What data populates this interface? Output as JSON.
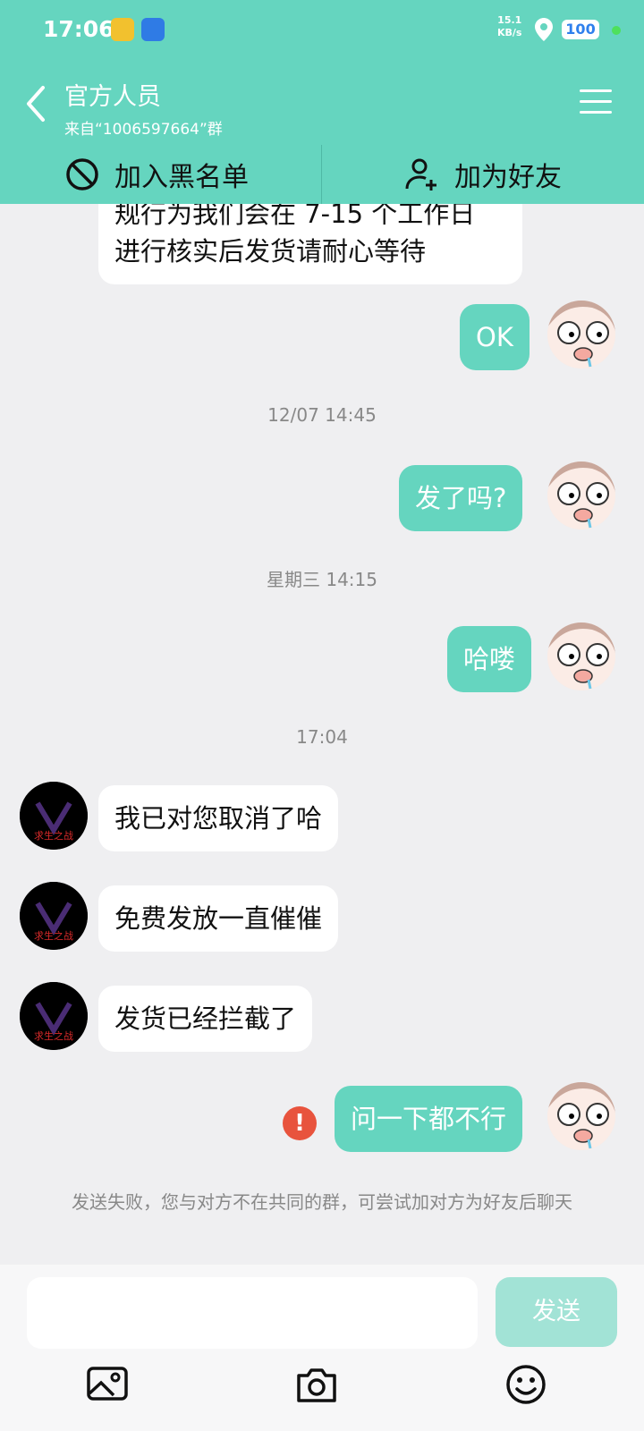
{
  "status_bar": {
    "time": "17:06",
    "net_speed_value": "15.1",
    "net_speed_unit": "KB/s",
    "battery": "100"
  },
  "header": {
    "title": "官方人员",
    "subtitle": "来自“1006597664”群",
    "blacklist_label": "加入黑名单",
    "add_friend_label": "加为好友"
  },
  "messages": [
    {
      "type": "in",
      "text_line1": "规行为我们会在 7-15 个工作日",
      "text_line2": "进行核实后发货请耐心等待"
    },
    {
      "type": "out",
      "text": "OK"
    },
    {
      "type": "time",
      "text": "12/07 14:45"
    },
    {
      "type": "out",
      "text": "发了吗?"
    },
    {
      "type": "time",
      "text": "星期三 14:15"
    },
    {
      "type": "out",
      "text": "哈喽"
    },
    {
      "type": "time",
      "text": "17:04"
    },
    {
      "type": "in",
      "text": "我已对您取消了哈"
    },
    {
      "type": "in",
      "text": "免费发放一直催催"
    },
    {
      "type": "in",
      "text": "发货已经拦截了"
    },
    {
      "type": "out",
      "text": "问一下都不行",
      "failed": true
    }
  ],
  "avatar_other_label": "求生之战",
  "send_fail_notice": "发送失败，您与对方不在共同的群，可尝试加对方为好友后聊天",
  "composer": {
    "input_value": "",
    "send_label": "发送"
  },
  "colors": {
    "accent": "#65d5bf",
    "background": "#efeff1",
    "error": "#e8533d",
    "send_disabled": "#a2e3d6"
  },
  "icons": [
    "back-arrow-icon",
    "menu-icon",
    "block-icon",
    "add-user-icon",
    "image-icon",
    "camera-icon",
    "emoji-icon",
    "error-icon",
    "location-icon"
  ]
}
